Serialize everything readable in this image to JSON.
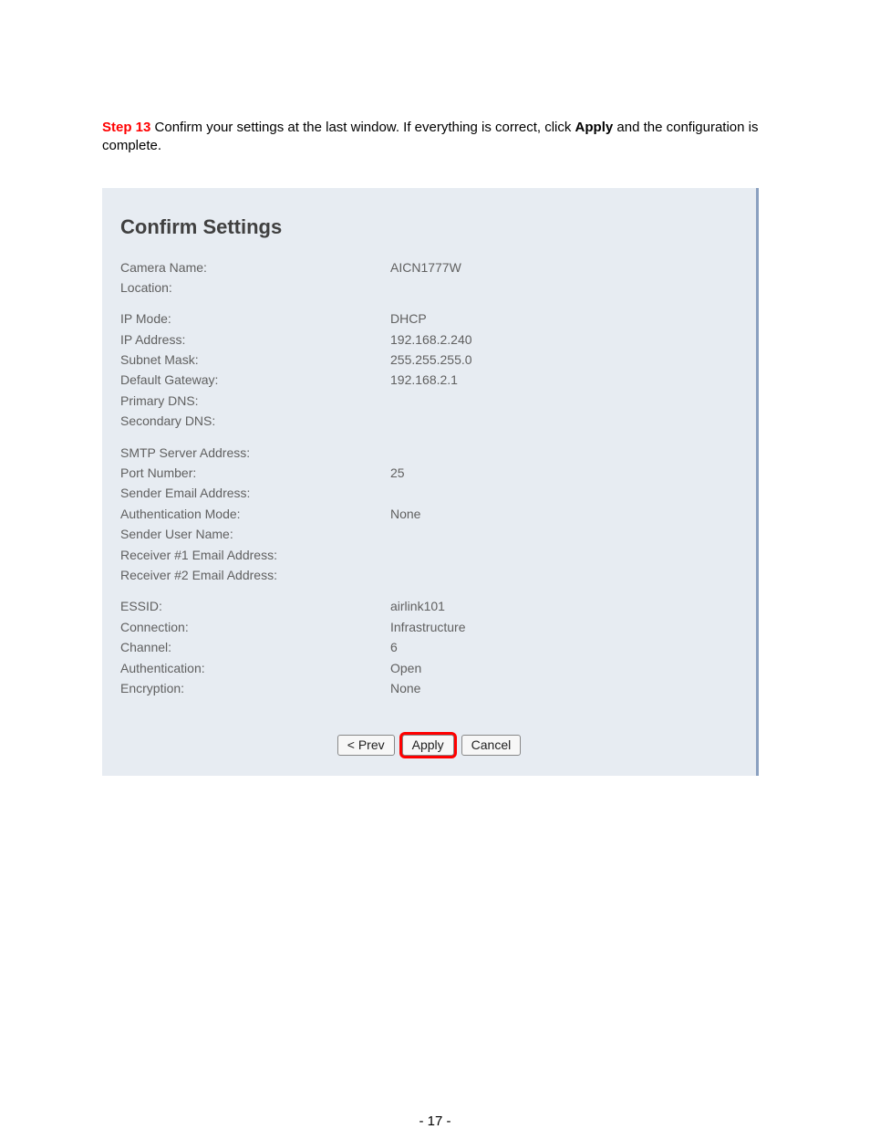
{
  "intro": {
    "step_label": "Step 13",
    "text_before": " Confirm your settings at the last window.  If everything is correct, click ",
    "bold_word": "Apply",
    "text_after": " and the configuration is complete."
  },
  "panel": {
    "title": "Confirm Settings",
    "groups": [
      [
        {
          "label": "Camera Name:",
          "value": "AICN1777W"
        },
        {
          "label": "Location:",
          "value": ""
        }
      ],
      [
        {
          "label": "IP Mode:",
          "value": "DHCP"
        },
        {
          "label": "IP Address:",
          "value": "192.168.2.240"
        },
        {
          "label": "Subnet Mask:",
          "value": "255.255.255.0"
        },
        {
          "label": "Default Gateway:",
          "value": "192.168.2.1"
        },
        {
          "label": "Primary DNS:",
          "value": ""
        },
        {
          "label": "Secondary DNS:",
          "value": ""
        }
      ],
      [
        {
          "label": "SMTP Server Address:",
          "value": ""
        },
        {
          "label": "Port Number:",
          "value": "25"
        },
        {
          "label": "Sender Email Address:",
          "value": ""
        },
        {
          "label": "Authentication Mode:",
          "value": "None"
        },
        {
          "label": "Sender User Name:",
          "value": ""
        },
        {
          "label": "Receiver #1 Email Address:",
          "value": ""
        },
        {
          "label": "Receiver #2 Email Address:",
          "value": ""
        }
      ],
      [
        {
          "label": "ESSID:",
          "value": "airlink101"
        },
        {
          "label": "Connection:",
          "value": "Infrastructure"
        },
        {
          "label": "Channel:",
          "value": "6"
        },
        {
          "label": "Authentication:",
          "value": "Open"
        },
        {
          "label": "Encryption:",
          "value": "None"
        }
      ]
    ],
    "buttons": {
      "prev": "< Prev",
      "apply": "Apply",
      "cancel": "Cancel"
    }
  },
  "page_number": "- 17 -"
}
